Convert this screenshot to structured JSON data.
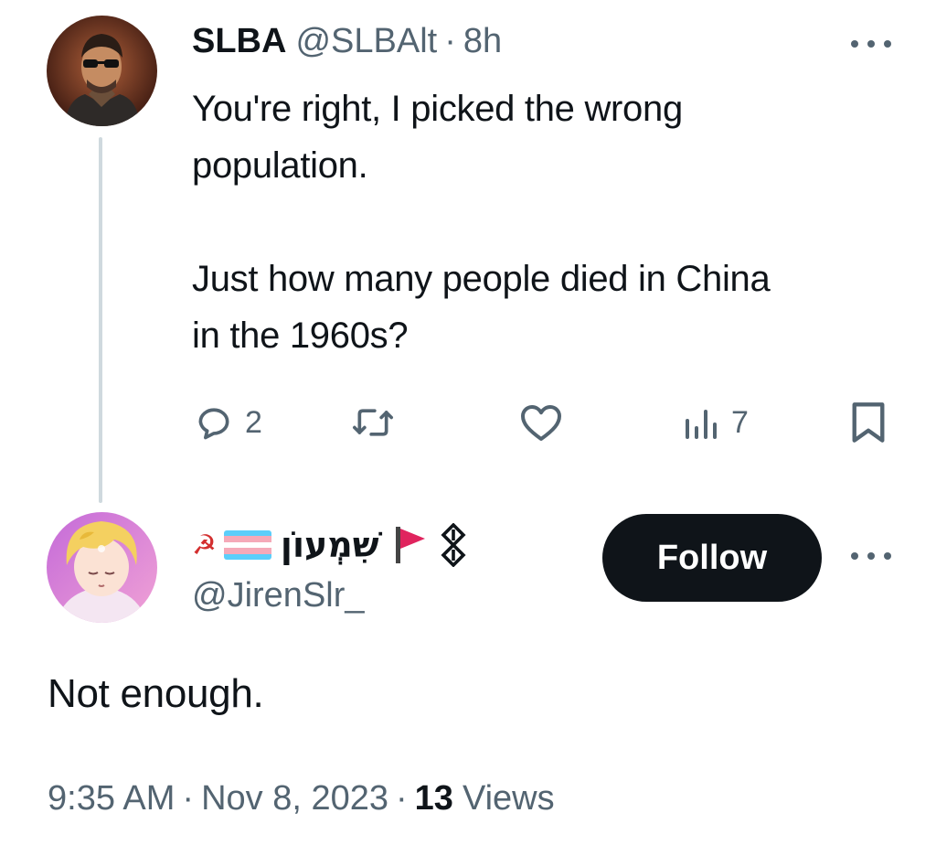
{
  "colors": {
    "text_primary": "#0f1419",
    "text_secondary": "#536471",
    "thread_line": "#cfd9de",
    "follow_button_bg": "#0f1419",
    "follow_button_text": "#ffffff"
  },
  "parent_tweet": {
    "display_name": "SLBA",
    "handle": "@SLBAlt",
    "separator": "·",
    "time": "8h",
    "text": "You're right, I picked the wrong\npopulation.\n\nJust how many people died in China\nin the 1960s?",
    "actions": {
      "reply_icon": "reply-icon",
      "reply_count": "2",
      "retweet_icon": "retweet-icon",
      "like_icon": "heart-icon",
      "views_icon": "views-bar-chart-icon",
      "views_count": "7",
      "bookmark_icon": "bookmark-icon"
    }
  },
  "reply_tweet": {
    "display_name": "שִׁמְעוֹן",
    "name_emojis": [
      "hammer-and-sickle",
      "transgender-flag",
      "red-flag",
      "symbol"
    ],
    "handle": "@JirenSlr_",
    "follow_label": "Follow",
    "text": "Not enough.",
    "timestamp": "9:35 AM",
    "date": "Nov 8, 2023",
    "views_count": "13",
    "views_label": "Views",
    "separator": "·"
  }
}
